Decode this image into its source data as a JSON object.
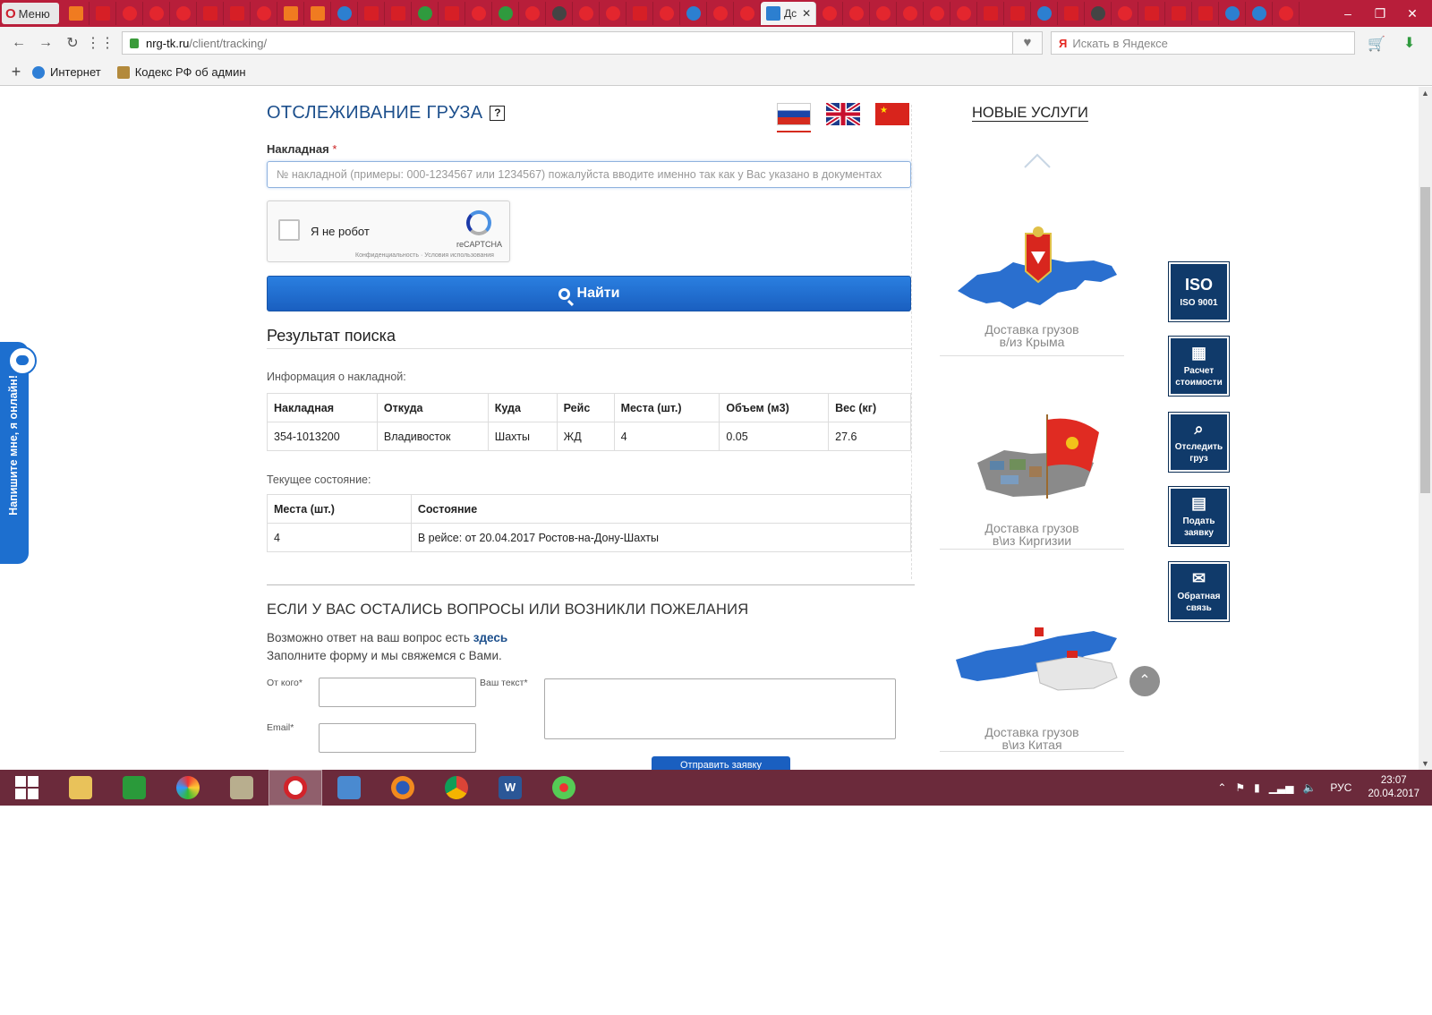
{
  "browser": {
    "menu_label": "Меню",
    "active_tab_title": "Дс",
    "url_host": "nrg-tk.ru",
    "url_path": "/client/tracking/",
    "search_placeholder": "Искать в Яндексе",
    "bookmarks": [
      "Интернет",
      "Кодекс РФ об админ"
    ]
  },
  "tracking": {
    "title": "Отслеживание груза",
    "help_label": "?",
    "waybill_label": "Накладная",
    "required_mark": "*",
    "waybill_placeholder": "№ накладной (примеры: 000-1234567 или 1234567) пожалуйста вводите именно так как у Вас указано в документах",
    "captcha_label": "Я не робот",
    "captcha_brand": "reCAPTCHA",
    "captcha_terms": "Конфиденциальность · Условия использования",
    "find_button": "Найти"
  },
  "result": {
    "title": "Результат поиска",
    "info_label": "Информация о накладной:",
    "waybill_columns": [
      "Накладная",
      "Откуда",
      "Куда",
      "Рейс",
      "Места (шт.)",
      "Объем (м3)",
      "Вес (кг)"
    ],
    "waybill_rows": [
      [
        "354-1013200",
        "Владивосток",
        "Шахты",
        "ЖД",
        "4",
        "0.05",
        "27.6"
      ]
    ],
    "status_label": "Текущее состояние:",
    "status_columns": [
      "Места (шт.)",
      "Состояние"
    ],
    "status_rows": [
      [
        "4",
        "В рейсе: от 20.04.2017 Ростов-на-Дону-Шахты"
      ]
    ]
  },
  "feedback": {
    "title": "Если у вас остались вопросы или возникли пожелания",
    "answer_prefix": "Возможно ответ на ваш вопрос есть",
    "answer_link": "здесь",
    "form_hint": "Заполните форму и мы свяжемся с Вами.",
    "from_label": "От кого*",
    "email_label": "Email*",
    "text_label": "Ваш текст*",
    "submit_label": "Отправить заявку"
  },
  "services": {
    "title": "Новые услуги",
    "items": [
      {
        "line1": "Доставка грузов",
        "line2": "в/из Крыма"
      },
      {
        "line1": "Доставка грузов",
        "line2": "в\\из Киргизии"
      },
      {
        "line1": "Доставка грузов",
        "line2": "в\\из Китая"
      }
    ]
  },
  "side_buttons": [
    {
      "icon": "iso-icon",
      "title": "ISO",
      "label": "ISO 9001"
    },
    {
      "icon": "calculator-icon",
      "title": "",
      "label": "Расчет стоимости"
    },
    {
      "icon": "track-icon",
      "title": "",
      "label": "Отследить груз"
    },
    {
      "icon": "document-icon",
      "title": "",
      "label": "Подать заявку"
    },
    {
      "icon": "envelope-icon",
      "title": "",
      "label": "Обратная связь"
    }
  ],
  "chat": {
    "label": "Напишите мне, я онлайн!"
  },
  "taskbar": {
    "language": "РУС",
    "time": "23:07",
    "date": "20.04.2017"
  },
  "colors": {
    "brand_blue": "#1c4f8c",
    "button_blue": "#1a5fc0",
    "side_button": "#103a6a",
    "tab_bar": "#b81e3a",
    "taskbar": "#6b2a3b"
  }
}
